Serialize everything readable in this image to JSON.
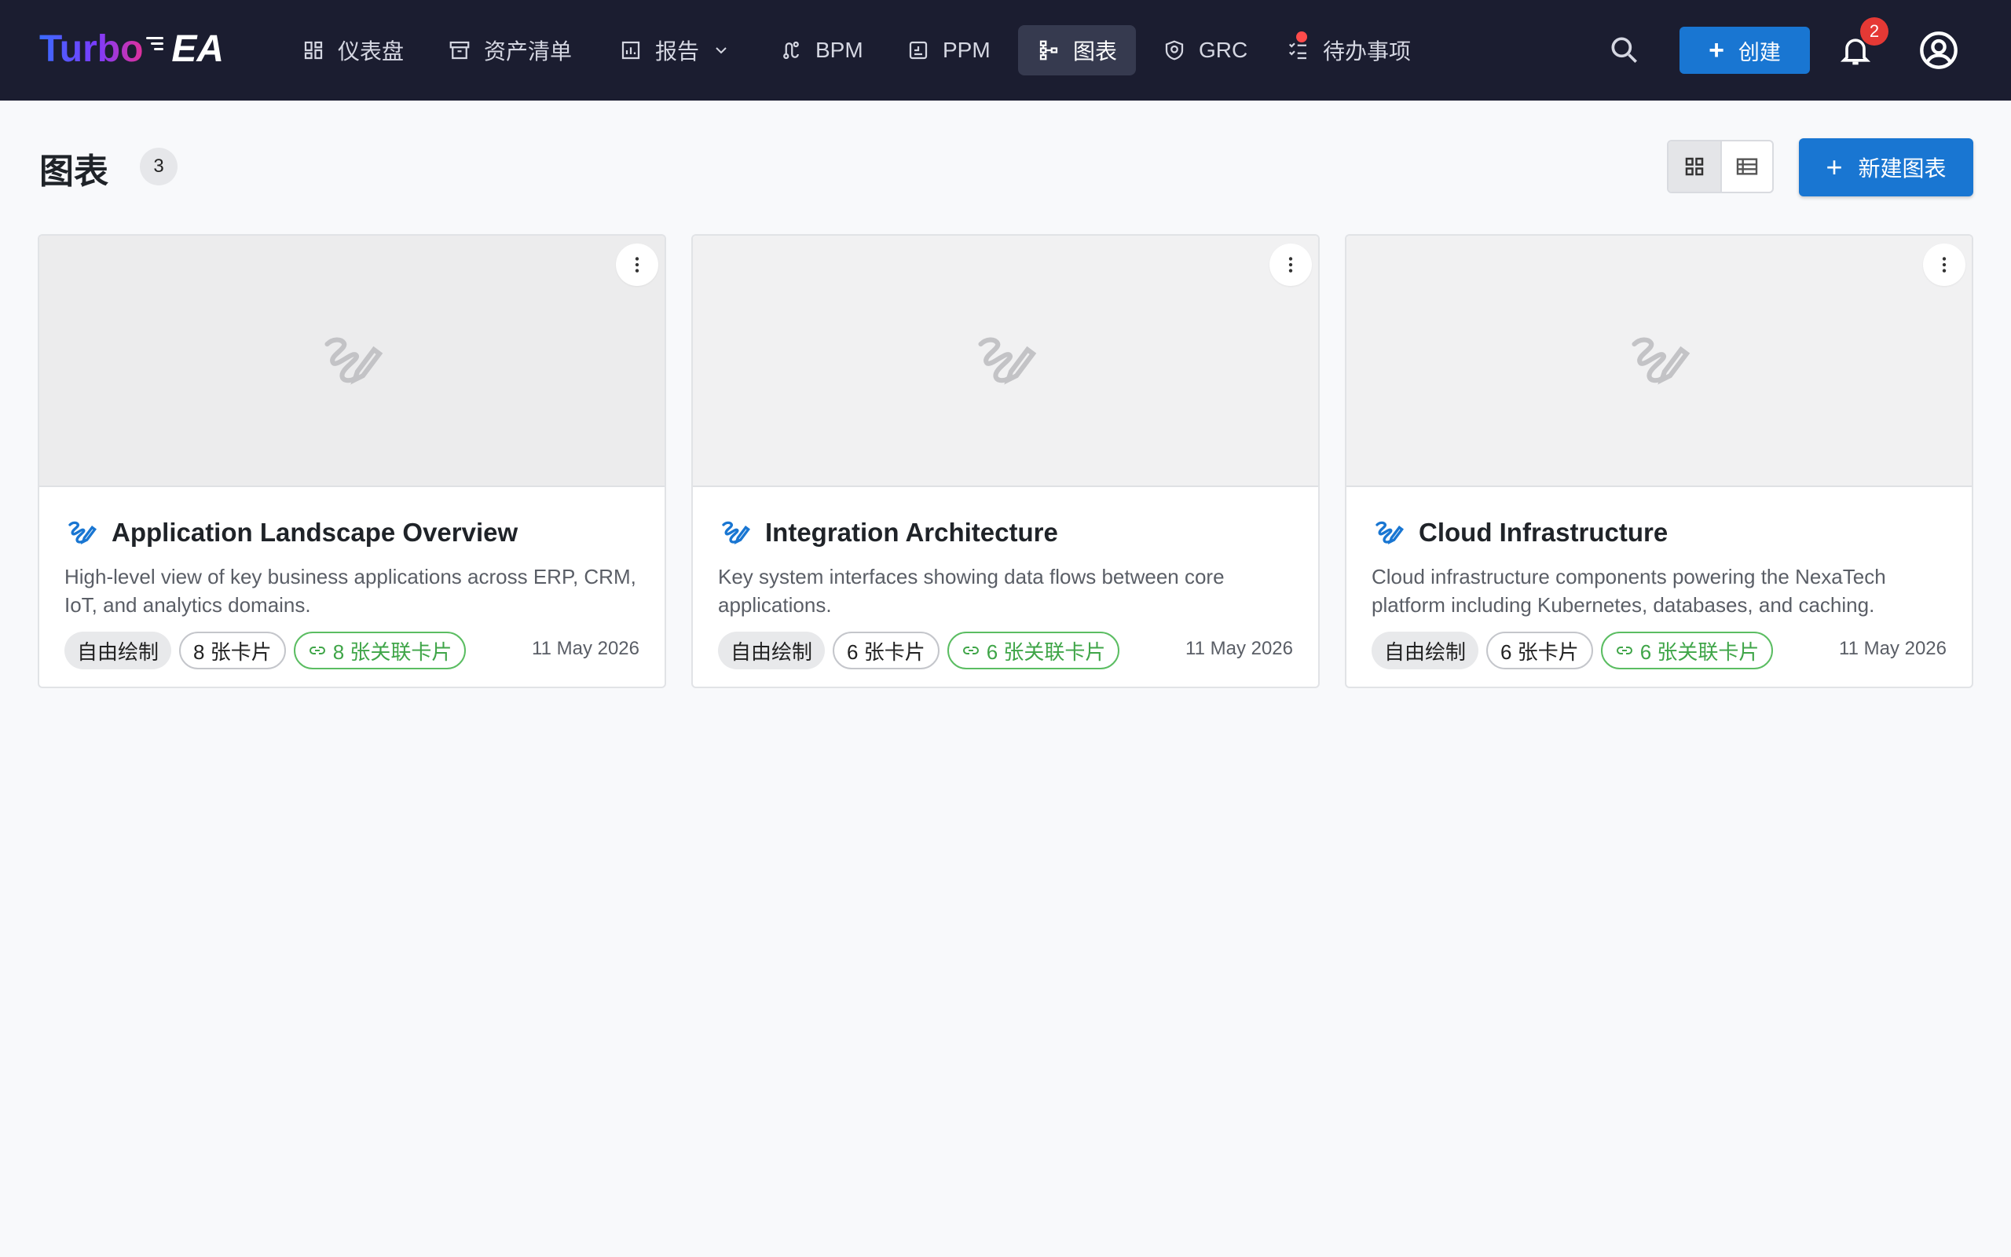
{
  "app": {
    "logo_part1": "Turbo",
    "logo_part2": "EA"
  },
  "nav": {
    "items": [
      {
        "label": "仪表盘",
        "icon": "dashboard-icon"
      },
      {
        "label": "资产清单",
        "icon": "inventory-icon"
      },
      {
        "label": "报告",
        "icon": "report-icon"
      },
      {
        "label": "BPM",
        "icon": "bpm-icon"
      },
      {
        "label": "PPM",
        "icon": "ppm-icon"
      },
      {
        "label": "图表",
        "icon": "diagram-icon",
        "active": true
      },
      {
        "label": "GRC",
        "icon": "shield-icon"
      },
      {
        "label": "待办事项",
        "icon": "todo-icon"
      }
    ],
    "create_label": "创建",
    "notification_count": "2"
  },
  "page": {
    "title": "图表",
    "count": "3",
    "new_button_label": "新建图表"
  },
  "cards": [
    {
      "title": "Application Landscape Overview",
      "description": "High-level view of key business applications across ERP, CRM, IoT, and analytics domains.",
      "type": "自由绘制",
      "cards_count": "8 张卡片",
      "linked_count": "8 张关联卡片",
      "date": "11 May 2026"
    },
    {
      "title": "Integration Architecture",
      "description": "Key system interfaces showing data flows between core applications.",
      "type": "自由绘制",
      "cards_count": "6 张卡片",
      "linked_count": "6 张关联卡片",
      "date": "11 May 2026"
    },
    {
      "title": "Cloud Infrastructure",
      "description": "Cloud infrastructure components powering the NexaTech platform including Kubernetes, databases, and caching.",
      "type": "自由绘制",
      "cards_count": "6 张卡片",
      "linked_count": "6 张关联卡片",
      "date": "11 May 2026"
    }
  ],
  "colors": {
    "topbar": "#1b1d30",
    "primary": "#1976d2",
    "linked_chip": "#3fa548",
    "badge": "#e53935"
  }
}
